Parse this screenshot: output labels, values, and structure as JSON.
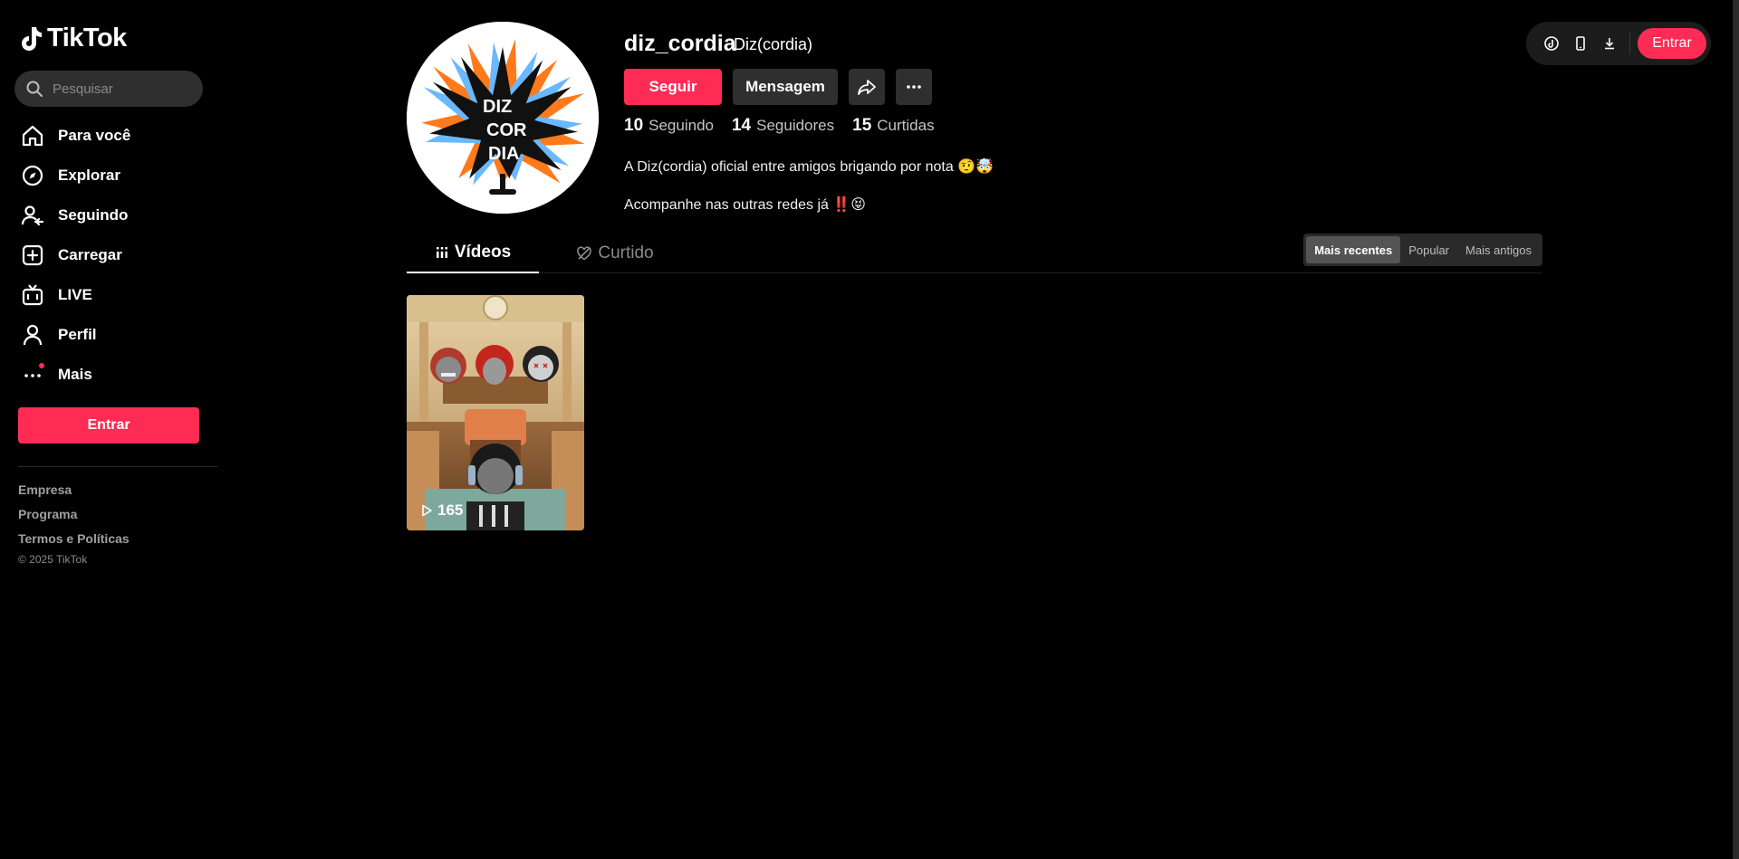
{
  "app": {
    "name": "TikTok",
    "brand_color": "#fe2c55"
  },
  "search": {
    "placeholder": "Pesquisar"
  },
  "nav": {
    "items": [
      {
        "label": "Para você",
        "icon": "home-icon"
      },
      {
        "label": "Explorar",
        "icon": "compass-icon"
      },
      {
        "label": "Seguindo",
        "icon": "following-icon"
      },
      {
        "label": "Carregar",
        "icon": "upload-icon"
      },
      {
        "label": "LIVE",
        "icon": "live-icon"
      },
      {
        "label": "Perfil",
        "icon": "profile-icon"
      },
      {
        "label": "Mais",
        "icon": "more-icon"
      }
    ],
    "login_label": "Entrar"
  },
  "footer": {
    "links": [
      "Empresa",
      "Programa",
      "Termos e Políticas"
    ],
    "copyright": "© 2025 TikTok"
  },
  "header": {
    "login_label": "Entrar"
  },
  "profile": {
    "username": "diz_cordia",
    "nickname": "Diz(cordia)",
    "follow_label": "Seguir",
    "message_label": "Mensagem",
    "stats": [
      {
        "value": "10",
        "label": "Seguindo"
      },
      {
        "value": "14",
        "label": "Seguidores"
      },
      {
        "value": "15",
        "label": "Curtidas"
      }
    ],
    "bio_lines": [
      "A Diz(cordia) oficial entre amigos brigando por nota 🤨🤯",
      "Acompanhe nas outras redes já ‼️😝"
    ],
    "avatar_text": "DIZ COR DIA"
  },
  "tabs": [
    {
      "label": "Vídeos",
      "active": true
    },
    {
      "label": "Curtido",
      "active": false
    }
  ],
  "sort": {
    "options": [
      "Mais recentes",
      "Popular",
      "Mais antigos"
    ],
    "selected": "Mais recentes"
  },
  "videos": [
    {
      "views": "165"
    }
  ]
}
